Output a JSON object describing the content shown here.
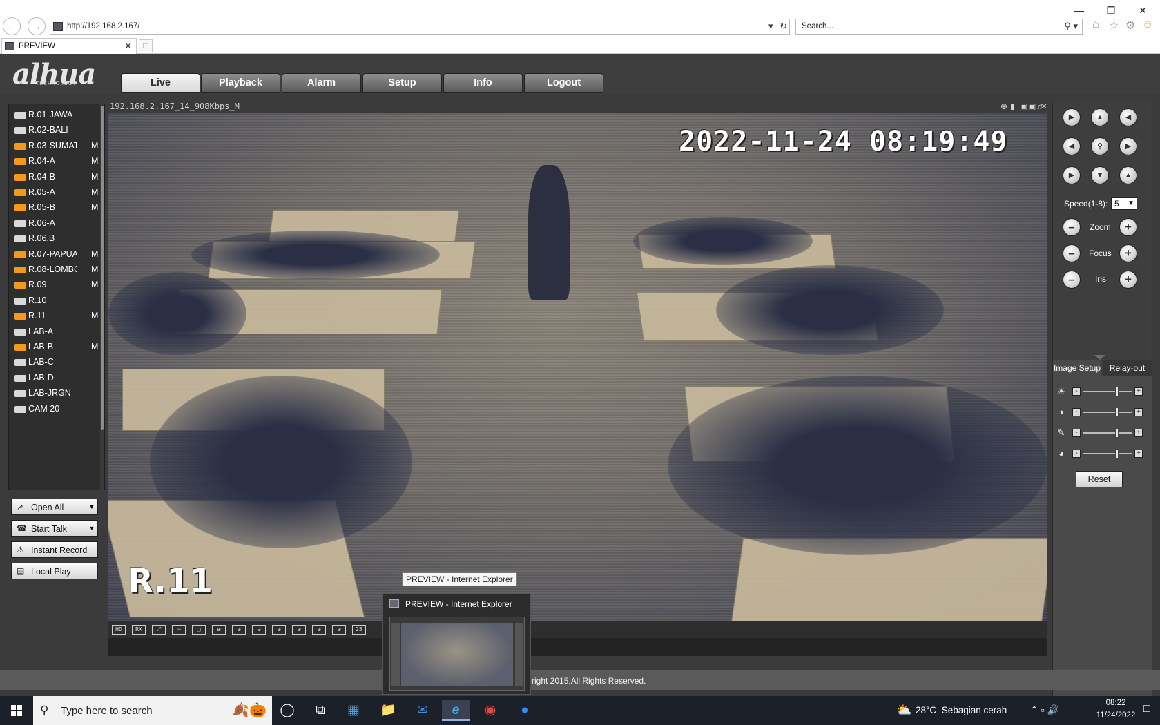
{
  "browser": {
    "url": "http://192.168.2.167/",
    "search_placeholder": "Search...",
    "tab_title": "PREVIEW"
  },
  "app": {
    "logo": "alhua",
    "logo_sub": "TECHNOLOGY",
    "tabs": [
      {
        "label": "Live"
      },
      {
        "label": "Playback"
      },
      {
        "label": "Alarm"
      },
      {
        "label": "Setup"
      },
      {
        "label": "Info"
      },
      {
        "label": "Logout"
      }
    ],
    "channels": [
      {
        "name": "R.01-JAWA",
        "m": "",
        "active": false
      },
      {
        "name": "R.02-BALI",
        "m": "",
        "active": false
      },
      {
        "name": "R.03-SUMAT",
        "m": "M",
        "active": true
      },
      {
        "name": "R.04-A",
        "m": "M",
        "active": true
      },
      {
        "name": "R.04-B",
        "m": "M",
        "active": true
      },
      {
        "name": "R.05-A",
        "m": "M",
        "active": true
      },
      {
        "name": "R.05-B",
        "m": "M",
        "active": true
      },
      {
        "name": "R.06-A",
        "m": "",
        "active": false
      },
      {
        "name": "R.06.B",
        "m": "",
        "active": false
      },
      {
        "name": "R.07-PAPUA",
        "m": "M",
        "active": true
      },
      {
        "name": "R.08-LOMBC",
        "m": "M",
        "active": true
      },
      {
        "name": "R.09",
        "m": "M",
        "active": true
      },
      {
        "name": "R.10",
        "m": "",
        "active": false
      },
      {
        "name": "R.11",
        "m": "M",
        "active": true
      },
      {
        "name": "LAB-A",
        "m": "",
        "active": false
      },
      {
        "name": "LAB-B",
        "m": "M",
        "active": true
      },
      {
        "name": "LAB-C",
        "m": "",
        "active": false
      },
      {
        "name": "LAB-D",
        "m": "",
        "active": false
      },
      {
        "name": "LAB-JRGN",
        "m": "",
        "active": false
      },
      {
        "name": "CAM 20",
        "m": "",
        "active": false
      }
    ],
    "actions": {
      "open_all": "Open All",
      "start_talk": "Start Talk",
      "instant_record": "Instant Record",
      "local_play": "Local Play"
    },
    "video": {
      "stream_title": "192.168.2.167_14_908Kbps_M",
      "timestamp": "2022-11-24 08:19:49",
      "camera_label": "R.11"
    },
    "split_buttons": [
      "HD",
      "RX",
      "⤢",
      "▭",
      "□",
      "⊞",
      "⊞",
      "⊟",
      "⊞",
      "⊞",
      "⊞",
      "⊞",
      "25"
    ],
    "ptz": {
      "speed_label": "Speed(1-8):",
      "speed_value": "5",
      "zoom_label": "Zoom",
      "focus_label": "Focus",
      "iris_label": "Iris",
      "image_setup_tab": "Image Setup",
      "relay_out_tab": "Relay-out",
      "sliders": [
        {
          "icon": "brightness-icon",
          "level": 0.7
        },
        {
          "icon": "contrast-icon",
          "level": 0.7
        },
        {
          "icon": "saturation-icon",
          "level": 0.7
        },
        {
          "icon": "hue-icon",
          "level": 0.7
        }
      ],
      "reset": "Reset"
    },
    "copyright": "right 2015,All Rights Reserved."
  },
  "taskbar": {
    "search_placeholder": "Type here to search",
    "weather_temp": "28°C",
    "weather_desc": "Sebagian cerah",
    "time": "08:22",
    "date": "11/24/2022",
    "preview_tooltip": "PREVIEW - Internet Explorer",
    "preview_title": "PREVIEW - Internet Explorer"
  },
  "colors": {
    "active_channel": "#f39a1c",
    "inactive_channel": "#d9d9d9",
    "app_background": "#3b3b3b"
  }
}
